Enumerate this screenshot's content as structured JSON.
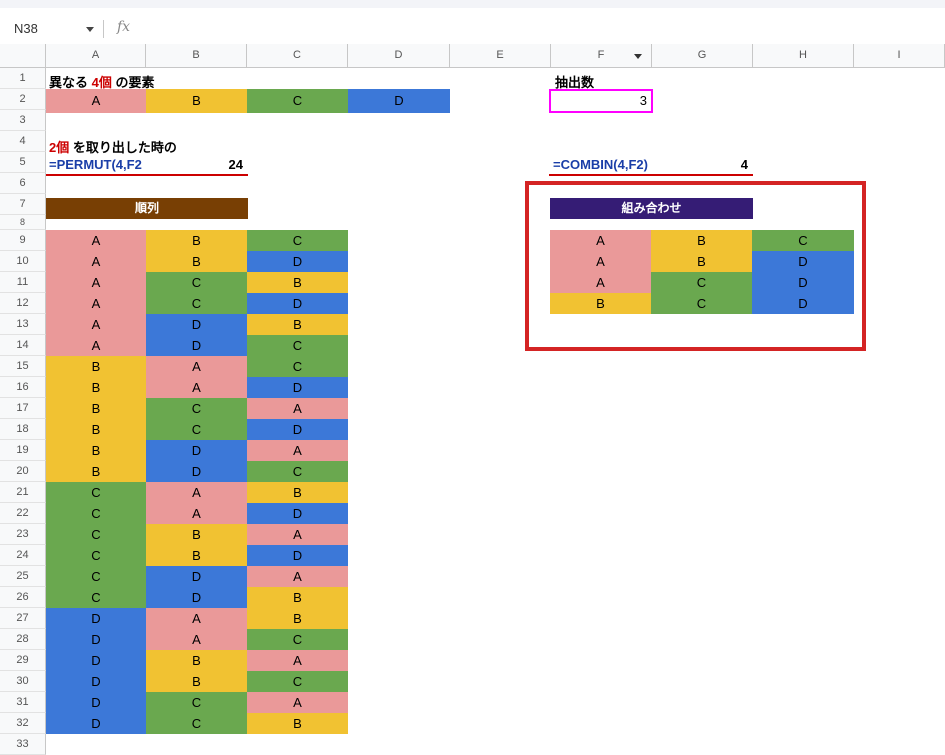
{
  "formula_bar": {
    "name_box": "N38",
    "fx_icon": "fx"
  },
  "columns": [
    "A",
    "B",
    "C",
    "D",
    "E",
    "F",
    "G",
    "H",
    "I"
  ],
  "rows": [
    "1",
    "2",
    "3",
    "4",
    "5",
    "6",
    "7",
    "8",
    "9",
    "10",
    "11",
    "12",
    "13",
    "14",
    "15",
    "16",
    "17",
    "18",
    "19",
    "20",
    "21",
    "22",
    "23",
    "24",
    "25",
    "26",
    "27",
    "28",
    "29",
    "30",
    "31",
    "32",
    "33"
  ],
  "title": {
    "part1": "異なる ",
    "count": "4個",
    "part2": " の要素"
  },
  "elements": [
    "A",
    "B",
    "C",
    "D"
  ],
  "extract_label": "抽出数",
  "extract_value": "3",
  "subtitle": {
    "count": "2個",
    "rest": " を取り出した時の"
  },
  "permut": {
    "formula": "=PERMUT(4,F2",
    "result": "24"
  },
  "combin": {
    "formula": "=COMBIN(4,F2)",
    "result": "4"
  },
  "permutation_header": "順列",
  "combination_header": "組み合わせ",
  "colors": {
    "A": "#ea9999",
    "B": "#f1c232",
    "C": "#6aa84f",
    "D": "#3c78d8",
    "permutation_header": "#783f04",
    "combination_header": "#351c75",
    "input_border": "#ff00ff",
    "frame": "#d42424"
  },
  "permutations": [
    [
      "A",
      "B",
      "C"
    ],
    [
      "A",
      "B",
      "D"
    ],
    [
      "A",
      "C",
      "B"
    ],
    [
      "A",
      "C",
      "D"
    ],
    [
      "A",
      "D",
      "B"
    ],
    [
      "A",
      "D",
      "C"
    ],
    [
      "B",
      "A",
      "C"
    ],
    [
      "B",
      "A",
      "D"
    ],
    [
      "B",
      "C",
      "A"
    ],
    [
      "B",
      "C",
      "D"
    ],
    [
      "B",
      "D",
      "A"
    ],
    [
      "B",
      "D",
      "C"
    ],
    [
      "C",
      "A",
      "B"
    ],
    [
      "C",
      "A",
      "D"
    ],
    [
      "C",
      "B",
      "A"
    ],
    [
      "C",
      "B",
      "D"
    ],
    [
      "C",
      "D",
      "A"
    ],
    [
      "C",
      "D",
      "B"
    ],
    [
      "D",
      "A",
      "B"
    ],
    [
      "D",
      "A",
      "C"
    ],
    [
      "D",
      "B",
      "A"
    ],
    [
      "D",
      "B",
      "C"
    ],
    [
      "D",
      "C",
      "A"
    ],
    [
      "D",
      "C",
      "B"
    ]
  ],
  "combinations": [
    [
      "A",
      "B",
      "C"
    ],
    [
      "A",
      "B",
      "D"
    ],
    [
      "A",
      "C",
      "D"
    ],
    [
      "B",
      "C",
      "D"
    ]
  ]
}
